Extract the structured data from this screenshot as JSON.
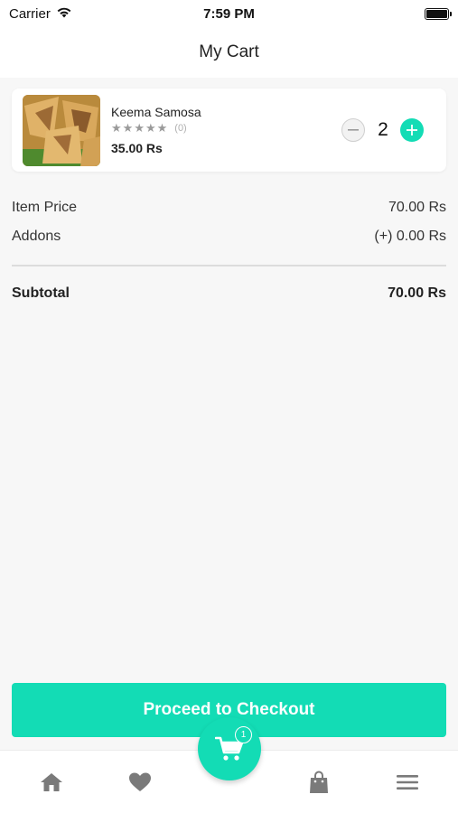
{
  "status_bar": {
    "carrier": "Carrier",
    "time": "7:59 PM",
    "icons": [
      "wifi-icon",
      "battery-icon"
    ]
  },
  "header": {
    "title": "My Cart"
  },
  "cart": {
    "items": [
      {
        "name": "Keema Samosa",
        "rating_count": "(0)",
        "rating_stars": 0,
        "price": "35.00 Rs",
        "quantity": "2",
        "decrement_icon": "minus-icon",
        "increment_icon": "plus-icon"
      }
    ]
  },
  "summary": {
    "item_price_label": "Item Price",
    "item_price_value": "70.00 Rs",
    "addons_label": "Addons",
    "addons_value": "(+) 0.00 Rs",
    "subtotal_label": "Subtotal",
    "subtotal_value": "70.00 Rs"
  },
  "checkout": {
    "label": "Proceed to Checkout"
  },
  "tab_bar": {
    "items": [
      "home-icon",
      "heart-icon",
      "cart-icon",
      "bag-icon",
      "menu-icon"
    ],
    "cart_badge": "1"
  },
  "colors": {
    "accent": "#13dcb5",
    "background": "#f7f7f7",
    "card": "#ffffff",
    "tab_icon": "#7a7a7a"
  }
}
